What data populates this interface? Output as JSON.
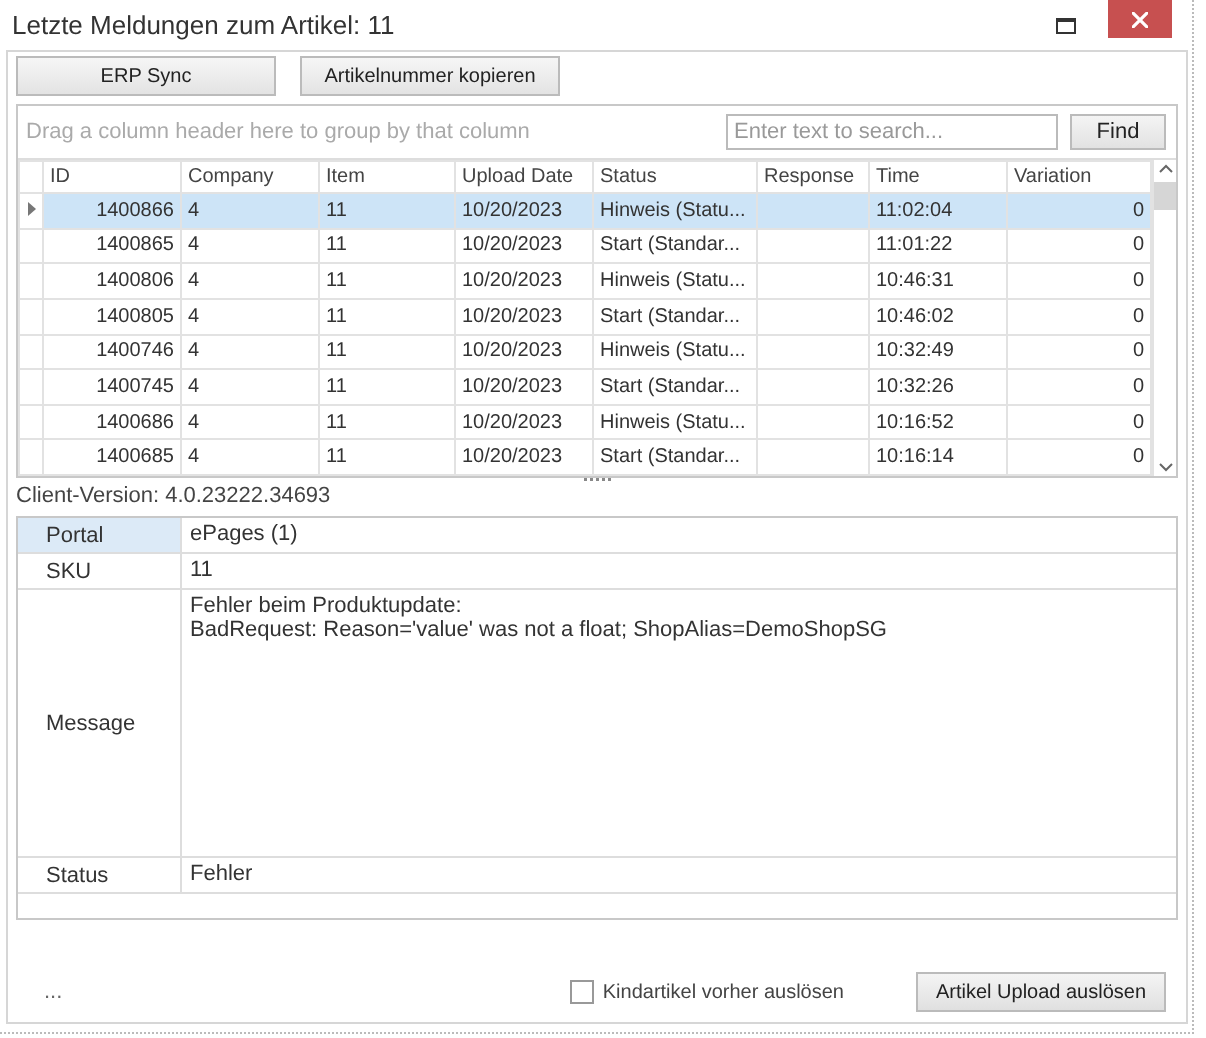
{
  "window": {
    "title": "Letzte Meldungen zum Artikel: 11"
  },
  "toolbar": {
    "buttons": [
      "ERP Sync",
      "Artikelnummer kopieren"
    ]
  },
  "grid": {
    "group_hint": "Drag a column header here to group by that column",
    "search": {
      "placeholder": "Enter text to search..."
    },
    "find_button": "Find",
    "columns": [
      "ID",
      "Company",
      "Item",
      "Upload Date",
      "Status",
      "Response",
      "Time",
      "Variation"
    ],
    "rows": [
      {
        "cells": [
          "1400866",
          "4",
          "11",
          "10/20/2023",
          "Hinweis (Statu...",
          "",
          "11:02:04",
          "0"
        ],
        "selected": true
      },
      {
        "cells": [
          "1400865",
          "4",
          "11",
          "10/20/2023",
          "Start (Standar...",
          "",
          "11:01:22",
          "0"
        ],
        "selected": false
      },
      {
        "cells": [
          "1400806",
          "4",
          "11",
          "10/20/2023",
          "Hinweis (Statu...",
          "",
          "10:46:31",
          "0"
        ],
        "selected": false
      },
      {
        "cells": [
          "1400805",
          "4",
          "11",
          "10/20/2023",
          "Start (Standar...",
          "",
          "10:46:02",
          "0"
        ],
        "selected": false
      },
      {
        "cells": [
          "1400746",
          "4",
          "11",
          "10/20/2023",
          "Hinweis (Statu...",
          "",
          "10:32:49",
          "0"
        ],
        "selected": false
      },
      {
        "cells": [
          "1400745",
          "4",
          "11",
          "10/20/2023",
          "Start (Standar...",
          "",
          "10:32:26",
          "0"
        ],
        "selected": false
      },
      {
        "cells": [
          "1400686",
          "4",
          "11",
          "10/20/2023",
          "Hinweis (Statu...",
          "",
          "10:16:52",
          "0"
        ],
        "selected": false
      },
      {
        "cells": [
          "1400685",
          "4",
          "11",
          "10/20/2023",
          "Start (Standar...",
          "",
          "10:16:14",
          "0"
        ],
        "selected": false
      }
    ]
  },
  "client_version": "Client-Version: 4.0.23222.34693",
  "properties": [
    {
      "label": "Portal",
      "value": "ePages (1)",
      "selected": true
    },
    {
      "label": "SKU",
      "value": "11",
      "selected": false
    },
    {
      "label": "Message",
      "value": "Fehler beim Produktupdate:\nBadRequest: Reason='value' was not a float; ShopAlias=DemoShopSG",
      "selected": false
    },
    {
      "label": "Status",
      "value": "Fehler",
      "selected": false
    }
  ],
  "footer": {
    "status": "...",
    "checkbox": {
      "label": "Kindartikel vorher auslösen",
      "checked": false
    },
    "button": "Artikel Upload auslösen"
  }
}
